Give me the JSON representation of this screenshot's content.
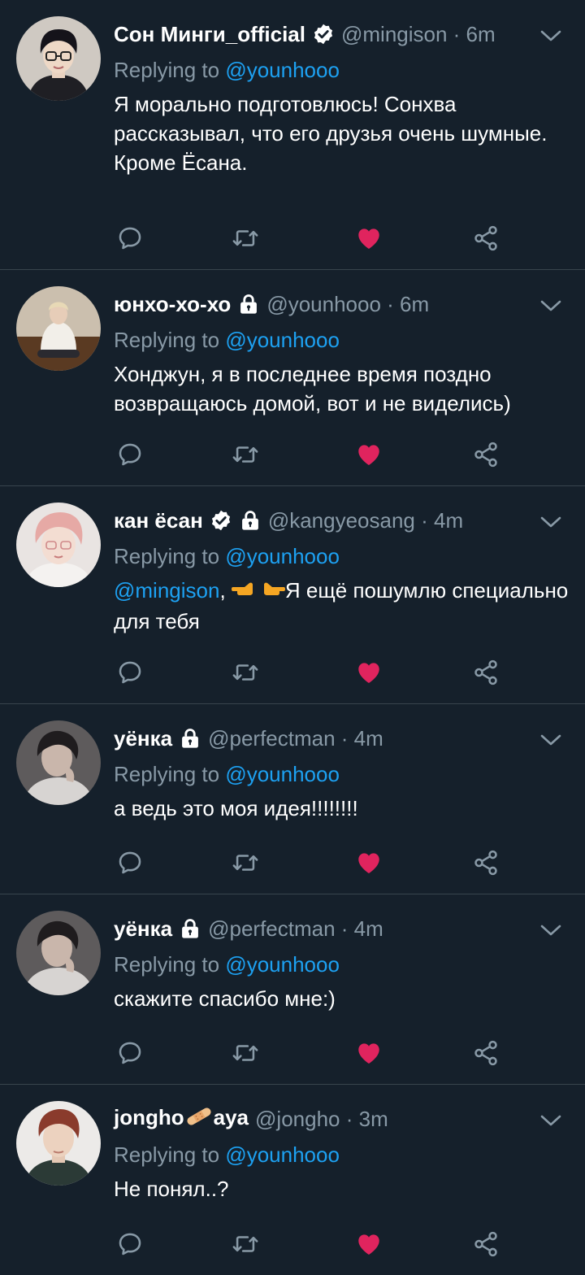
{
  "colors": {
    "background": "#15202b",
    "divider": "#38444d",
    "secondary_text": "#8899a6",
    "link": "#1da1f2",
    "like": "#e0245e"
  },
  "icons": {
    "reply": "speech-bubble-icon",
    "retweet": "retweet-icon",
    "like": "heart-icon",
    "share": "share-icon",
    "verified": "verified-badge-icon",
    "protected": "lock-icon",
    "menu": "chevron-down-icon"
  },
  "tweets": [
    {
      "name": "Сон Минги_official",
      "handle_time": "@mingison · 6m",
      "replying_prefix": "Replying to ",
      "replying_to": "@younhooo",
      "text": "Я морально подготовлюсь! Сонхва рассказывал, что его друзья очень шумные.\nКроме Ёсана."
    },
    {
      "name": "юнхо-хо-хо",
      "handle_time": "@younhooo · 6m",
      "replying_prefix": "Replying to ",
      "replying_to": "@younhooo",
      "text": "Хонджун, я в последнее время поздно возвращаюсь домой, вот и не виделись)"
    },
    {
      "name": "кан ёсан",
      "handle_time": "@kangyeosang · 4m",
      "replying_prefix": "Replying to ",
      "replying_to": "@younhooo",
      "text_mention": "@mingison",
      "text_after": ", ",
      "text_rest": "Я ещё пошумлю специально для тебя"
    },
    {
      "name": "уёнка",
      "handle_time": "@perfectman · 4m",
      "replying_prefix": "Replying to ",
      "replying_to": "@younhooo",
      "text": "а ведь это моя идея!!!!!!!!"
    },
    {
      "name": "уёнка",
      "handle_time": "@perfectman · 4m",
      "replying_prefix": "Replying to ",
      "replying_to": "@younhooo",
      "text": "скажите спасибо мне:)"
    },
    {
      "name_a": "jongho",
      "name_b": "aya",
      "handle_time": "@jongho · 3m",
      "replying_prefix": "Replying to ",
      "replying_to": "@younhooo",
      "text": "Не понял..?"
    }
  ]
}
